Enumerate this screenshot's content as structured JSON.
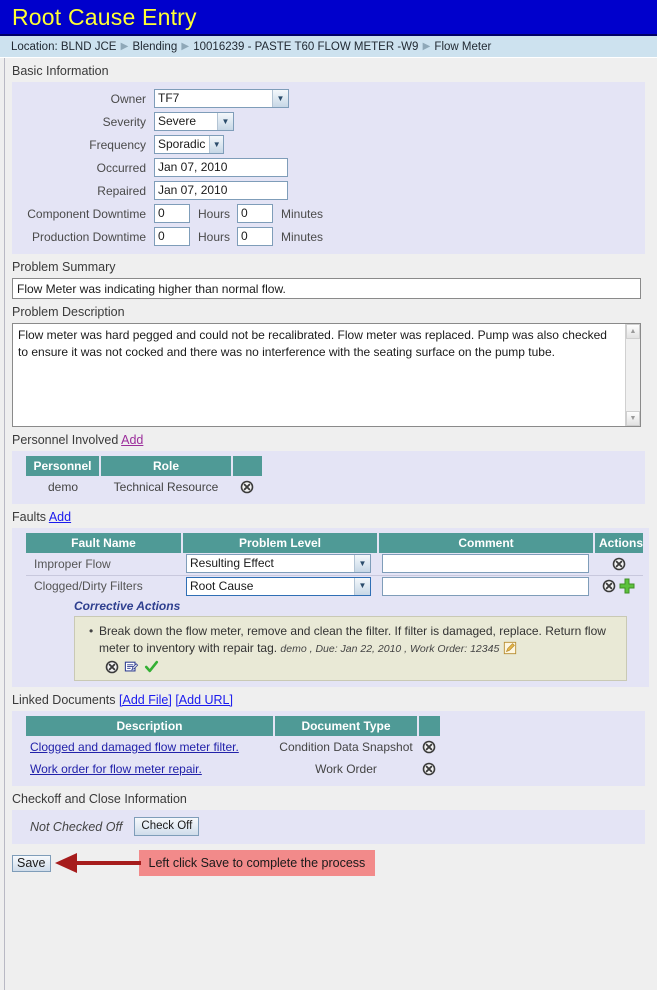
{
  "header": {
    "title": "Root Cause Entry"
  },
  "breadcrumb": {
    "items": [
      "Location: BLND JCE",
      "Blending",
      "10016239 - PASTE T60 FLOW METER -W9",
      "Flow Meter"
    ]
  },
  "basic_information": {
    "section_title": "Basic Information",
    "fields": [
      {
        "label": "Owner",
        "type": "select",
        "value": "TF7"
      },
      {
        "label": "Severity",
        "type": "select",
        "value": "Severe"
      },
      {
        "label": "Frequency",
        "type": "select",
        "value": "Sporadic"
      },
      {
        "label": "Occurred",
        "type": "text",
        "value": "Jan 07, 2010"
      },
      {
        "label": "Repaired",
        "type": "text",
        "value": "Jan 07, 2010"
      }
    ],
    "component_downtime": {
      "label": "Component Downtime",
      "hours": "0",
      "hours_unit": "Hours",
      "minutes": "0",
      "minutes_unit": "Minutes"
    },
    "production_downtime": {
      "label": "Production Downtime",
      "hours": "0",
      "hours_unit": "Hours",
      "minutes": "0",
      "minutes_unit": "Minutes"
    }
  },
  "problem_summary": {
    "section_title": "Problem Summary",
    "value": "Flow Meter was indicating higher than normal flow."
  },
  "problem_description": {
    "section_title": "Problem Description",
    "value": "Flow meter was hard pegged and could not be recalibrated. Flow meter was replaced.  Pump was also checked to ensure it was not cocked and there was no interference with the seating surface on the pump tube."
  },
  "personnel": {
    "section_title": "Personnel Involved",
    "add_label": "Add",
    "columns": [
      "Personnel",
      "Role",
      ""
    ],
    "rows": [
      {
        "personnel": "demo",
        "role": "Technical Resource"
      }
    ]
  },
  "faults": {
    "section_title": "Faults",
    "add_label": "Add",
    "columns": [
      "Fault Name",
      "Problem Level",
      "Comment",
      "Actions"
    ],
    "rows": [
      {
        "name": "Improper Flow",
        "level": "Resulting Effect",
        "comment": "",
        "focused": false,
        "has_add": false
      },
      {
        "name": "Clogged/Dirty Filters",
        "level": "Root Cause",
        "comment": "",
        "focused": true,
        "has_add": true
      }
    ],
    "corrective_actions": {
      "title": "Corrective Actions",
      "items": [
        {
          "text": "Break down the flow meter, remove and clean the filter. If filter is damaged, replace. Return flow meter to inventory with repair tag.",
          "meta": "demo , Due: Jan 22, 2010 , Work Order: 12345"
        }
      ]
    }
  },
  "linked_documents": {
    "section_title": "Linked Documents",
    "add_file_label": "[Add File]",
    "add_url_label": "[Add URL]",
    "columns": [
      "Description",
      "Document Type",
      ""
    ],
    "rows": [
      {
        "description": "Clogged and damaged flow meter filter.",
        "type": "Condition Data Snapshot"
      },
      {
        "description": "Work order for flow meter repair.",
        "type": "Work Order"
      }
    ]
  },
  "checkoff": {
    "section_title": "Checkoff and Close Information",
    "status": "Not Checked Off",
    "button_label": "Check Off"
  },
  "footer": {
    "save_label": "Save",
    "annotation": "Left click Save to complete the process"
  },
  "colors": {
    "title_bar": "#0000cc",
    "title_text": "#ffff33",
    "breadcrumb_bar": "#cde2ef",
    "panel": "#e4e4f5",
    "table_header": "#4f9a96",
    "annotation": "#f28a8a",
    "arrow": "#a61c1c"
  }
}
